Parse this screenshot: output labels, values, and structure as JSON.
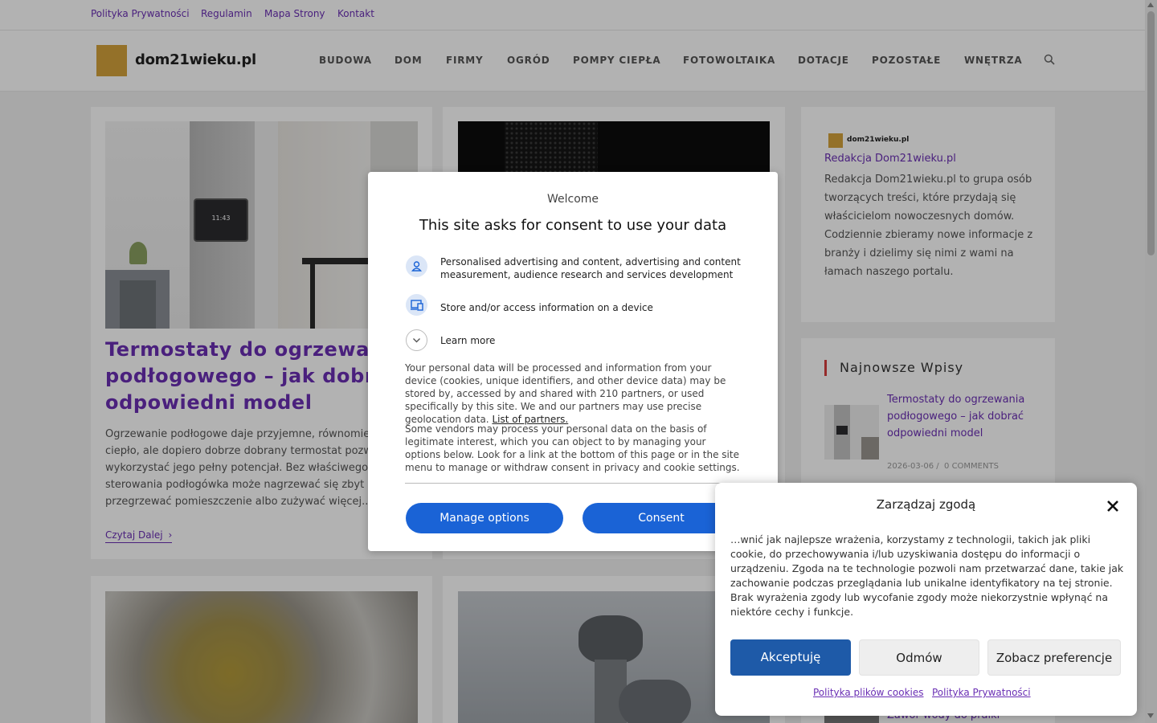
{
  "topbar": {
    "links": [
      "Polityka Prywatności",
      "Regulamin",
      "Mapa Strony",
      "Kontakt"
    ]
  },
  "header": {
    "logo_text": "dom21wieku.pl",
    "nav": [
      "BUDOWA",
      "DOM",
      "FIRMY",
      "OGRÓD",
      "POMPY CIEPŁA",
      "FOTOWOLTAIKA",
      "DOTACJE",
      "POZOSTAŁE",
      "WNĘTRZA"
    ],
    "search_icon": "search-icon"
  },
  "posts": [
    {
      "title": "Termostaty do ogrzewania podłogowego – jak dobrać odpowiedni model",
      "title_lines": [
        "Termostaty do ogrzewa",
        "podłogowego – jak dobr",
        "odpowiedni model"
      ],
      "excerpt_lines": [
        "Ogrzewanie podłogowe daje przyjemne, równomie",
        "ciepło, ale dopiero dobrze dobrany termostat pozw",
        "wykorzystać jego pełny potencjał. Bez właściwego",
        "sterowania podłogówka może nagrzewać się zbyt",
        "przegrzewać pomieszczenie albo zużywać więcej..."
      ],
      "read_more": "Czytaj Dalej",
      "thermostat_display": "11:43"
    }
  ],
  "sidebar": {
    "logo_text": "dom21wieku.pl",
    "author": "Redakcja Dom21wieku.pl",
    "bio": "Redakcja Dom21wieku.pl to grupa osób tworzących treści, które przydają się właścicielom nowoczesnych domów. Codziennie zbieramy nowe informacje z branży i dzielimy się nimi z wami na łamach naszego portalu.",
    "recent_heading": "Najnowsze Wpisy",
    "recent": [
      {
        "title": "Termostaty do ogrzewania podłogowego – jak dobrać odpowiedni model",
        "date": "2026-03-06",
        "comments": "0 COMMENTS"
      },
      {
        "title": "Zawór wody do pralki"
      }
    ]
  },
  "consent_modal": {
    "welcome": "Welcome",
    "title": "This site asks for consent to use your data",
    "purposes": [
      {
        "icon": "person-icon",
        "text": "Personalised advertising and content, advertising and content measurement, audience research and services development"
      },
      {
        "icon": "devices-icon",
        "text": "Store and/or access information on a device"
      }
    ],
    "learn_more": "Learn more",
    "paragraph1": "Your personal data will be processed and information from your device (cookies, unique identifiers, and other device data) may be stored by, accessed by and shared with 210 partners, or used specifically by this site. We and our partners may use precise geolocation data.",
    "partners_link": "List of partners.",
    "paragraph2": "Some vendors may process your personal data on the basis of legitimate interest, which you can object to by managing your options below. Look for a link at the bottom of this page or in the site menu to manage or withdraw consent in privacy and cookie settings.",
    "manage_button": "Manage options",
    "consent_button": "Consent",
    "accent_color": "#1a63d6"
  },
  "cookie_panel": {
    "title": "Zarządzaj zgodą",
    "text": "…wnić jak najlepsze wrażenia, korzystamy z technologii, takich jak pliki cookie, do przechowywania i/lub uzyskiwania dostępu do informacji o urządzeniu. Zgoda na te technologie pozwoli nam przetwarzać dane, takie jak zachowanie podczas przeglądania lub unikalne identyfikatory na tej stronie. Brak wyrażenia zgody lub wycofanie zgody może niekorzystnie wpłynąć na niektóre cechy i funkcje.",
    "accept": "Akceptuję",
    "deny": "Odmów",
    "preferences": "Zobacz preferencje",
    "cookie_policy": "Polityka plików cookies",
    "privacy_policy": "Polityka Prywatności"
  },
  "colors": {
    "link_purple": "#6a2fb4",
    "logo_gold": "#d4a23c",
    "accept_blue": "#1e5aa8"
  }
}
